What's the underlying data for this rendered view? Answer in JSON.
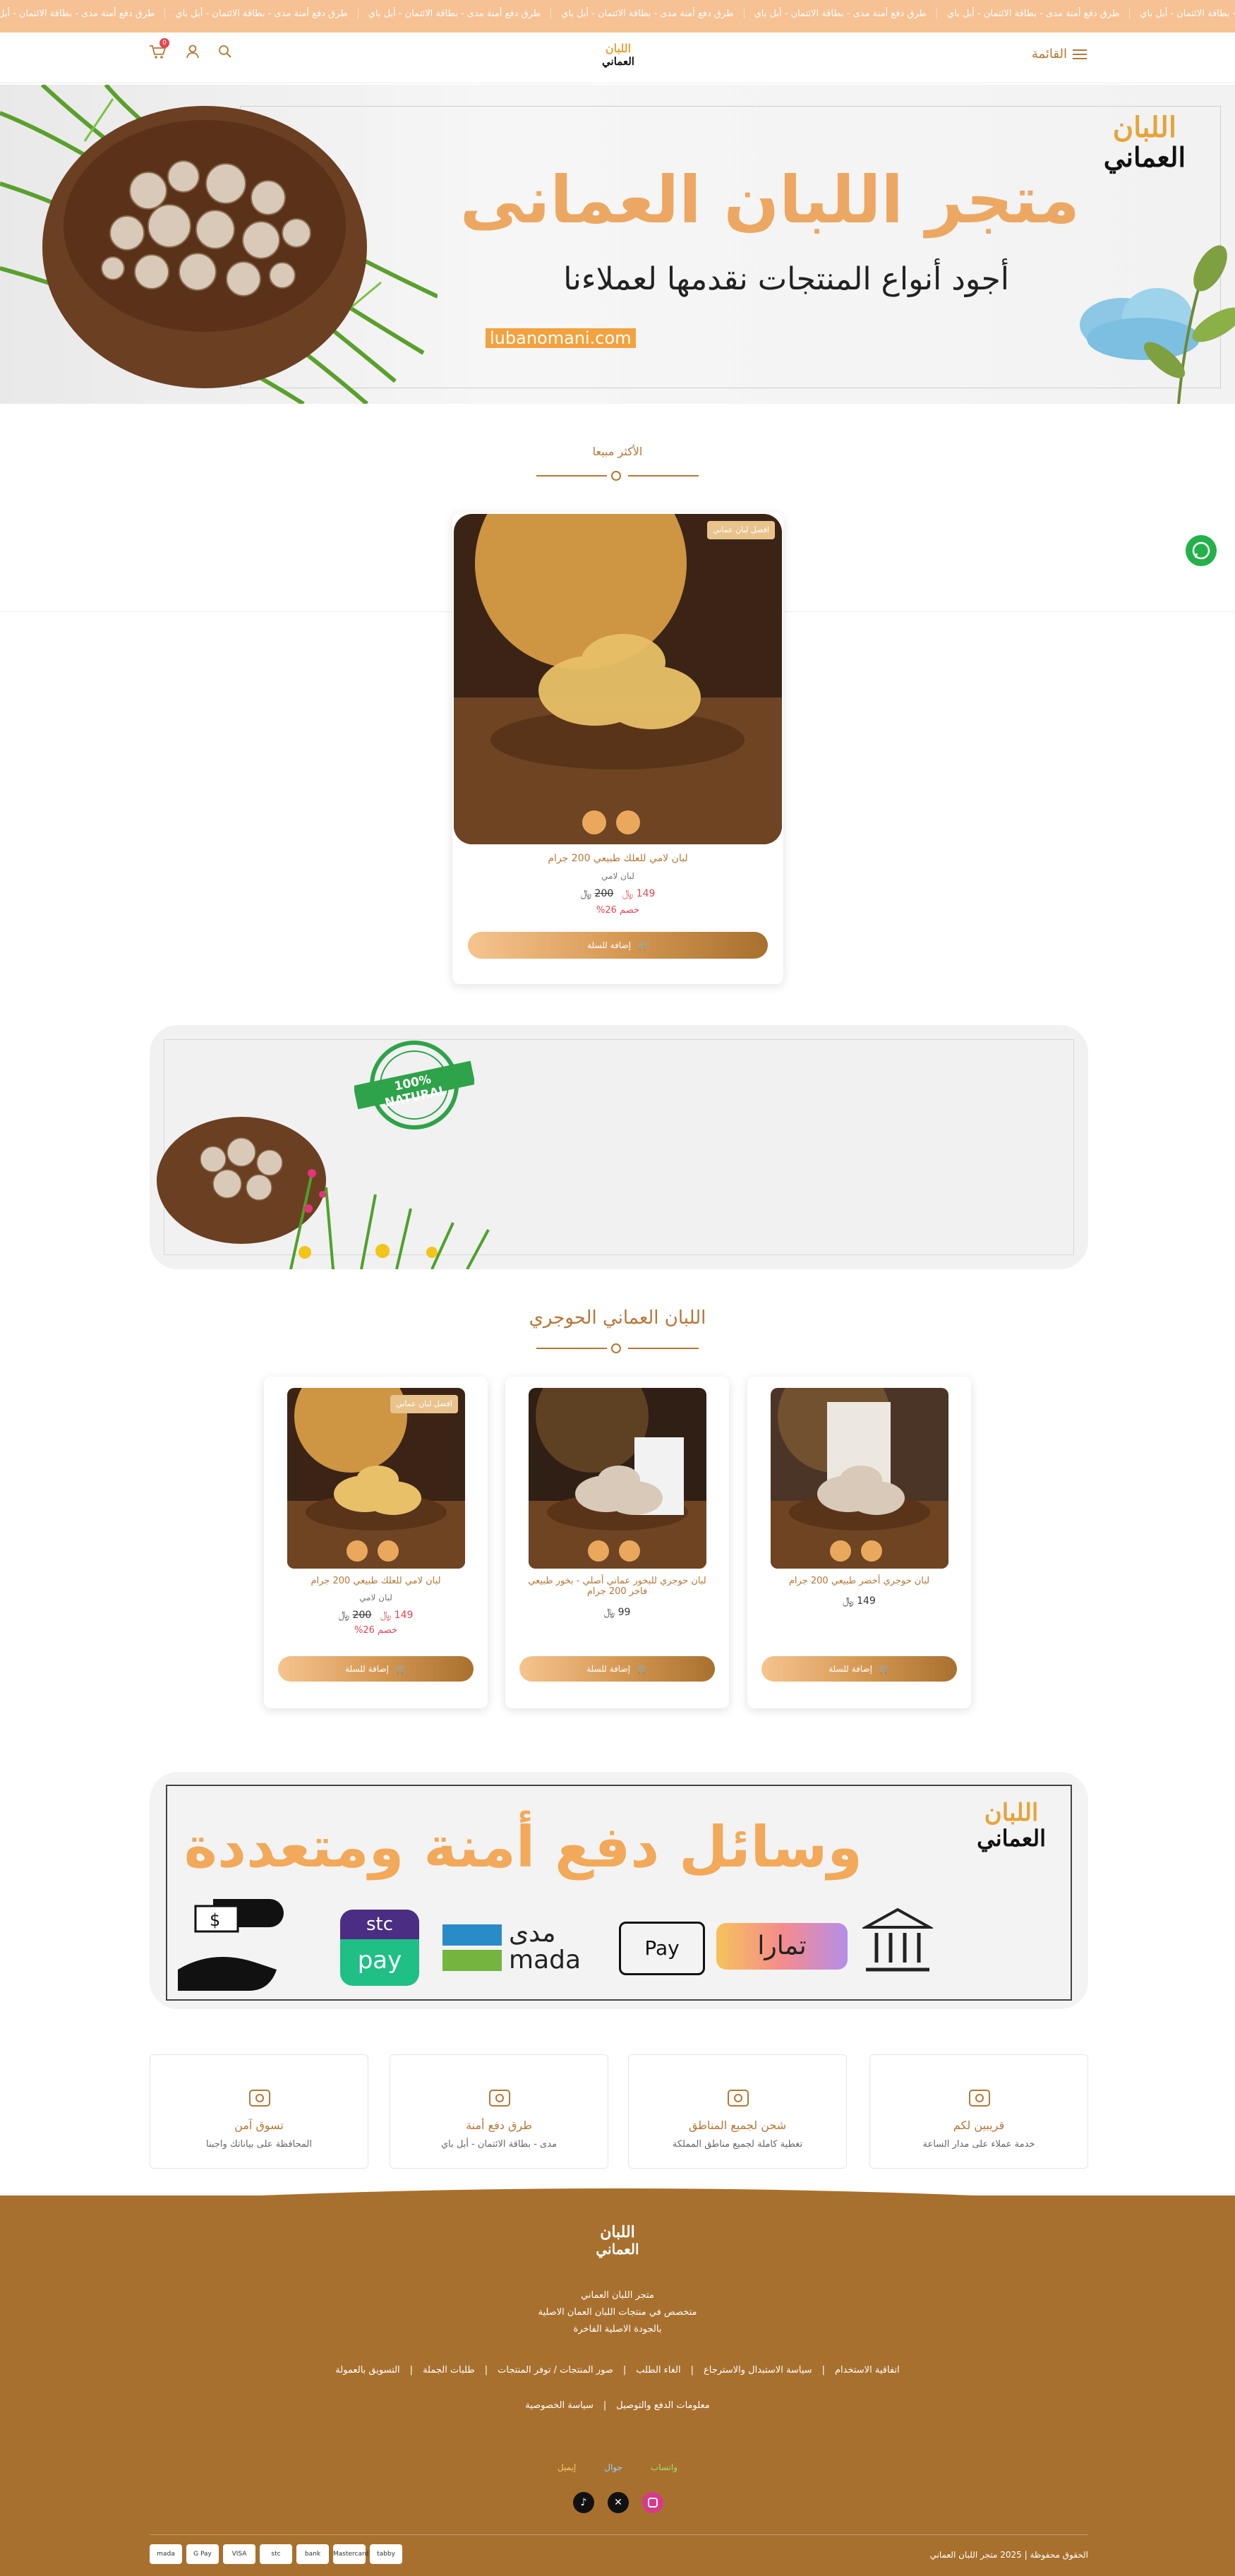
{
  "ticker": {
    "items": [
      "طرق دفع أمنة مدى - بطاقة الائتمان - أبل باي",
      "طرق دفع أمنة مدى - بطاقة الائتمان - أبل باي",
      "طرق دفع أمنة مدى - بطاقة الائتمان - أبل باي",
      "طرق دفع أمنة مدى - بطاقة الائتمان - أبل باي",
      "طرق دفع أمنة مدى - بطاقة الائتمان - أبل باي",
      "طرق دفع أمنة مدى - بطاقة الائتمان - أبل باي",
      "طرق دفع أمنة مدى - بطاقة الائتمان - أبل باي",
      "طرق دفع أمنة مدى - بطاقة الائتمان - أبل باي"
    ]
  },
  "header": {
    "menu_label": "القائمة",
    "logo_top": "اللبان",
    "logo_bottom": "العماني",
    "cart_count": "0"
  },
  "hero": {
    "title": "متجر اللبان العمانى",
    "subtitle": "أجود أنواع المنتجات نقدمها لعملاءنا",
    "url": "lubanomani.com",
    "logo_top": "اللبان",
    "logo_bottom": "العماني"
  },
  "best_seller": {
    "title": "الأكثر مبيعا",
    "product": {
      "badge": "افضل لبان عماني",
      "name": "لبان لامي للعلك طبيعي 200 جرام",
      "category": "لبان لامي",
      "price_new": "149",
      "price_old": "200",
      "discount": "خصم 26%",
      "cart_label": "إضافة للسلة"
    }
  },
  "hojari": {
    "title": "اللبان العماني الحوجري",
    "products": [
      {
        "badge": "افضل لبان عماني",
        "name": "لبان لامي للعلك طبيعي 200 جرام",
        "category": "لبان لامي",
        "price_new": "149",
        "price_old": "200",
        "discount": "خصم 26%",
        "cart_label": "إضافة للسلة"
      },
      {
        "name": "لبان حوجري للبخور عماني أصلي - بخور طبيعي فاخر 200 جرام",
        "price": "99",
        "cart_label": "إضافة للسلة"
      },
      {
        "name": "لبان حوجري أخضر طبيعي 200 جرام",
        "price": "149",
        "cart_label": "إضافة للسلة"
      }
    ]
  },
  "natural_banner": {
    "stamp": "100% NATURAL"
  },
  "payment_banner": {
    "title": "وسائل دفع أمنة ومتعددة",
    "logo_top": "اللبان",
    "logo_bottom": "العماني",
    "methods": [
      "stc pay",
      "مدى mada",
      "Apple Pay",
      "تمارا"
    ]
  },
  "features": [
    {
      "title": "قريبين لكم",
      "desc": "خدمة عملاء على مدار الساعة"
    },
    {
      "title": "شحن لجميع المناطق",
      "desc": "تغطية كاملة لجميع مناطق المملكة"
    },
    {
      "title": "طرق دفع أمنة",
      "desc": "مدى - بطاقة الائتمان - أبل باي"
    },
    {
      "title": "تسوق آمن",
      "desc": "المحافظة على بياناتك واجبنا"
    }
  ],
  "footer": {
    "logo_top": "اللبان",
    "logo_bottom": "العماني",
    "store_name": "متجر اللبان العماني",
    "desc_line1": "متخصص في منتجات اللبان العمان الاصلية",
    "desc_line2": "بالجودة الاصلية الفاخرة",
    "links_row1": [
      "اتفاقية الاستخدام",
      "سياسة الاستبدال والاسترجاع",
      "الغاء الطلب",
      "صور المنتجات / توفر المنتجات",
      "طلبات الجملة",
      "التسويق بالعمولة"
    ],
    "links_row2": [
      "معلومات الدفع والتوصيل",
      "سياسة الخصوصية"
    ],
    "contact": {
      "whatsapp": "واتساب",
      "mobile": "جوال",
      "email": "إيميل"
    },
    "copyright": "الحقوق محفوظة | 2025 متجر اللبان العماني",
    "payments": [
      "mada",
      "G Pay",
      "VISA",
      "stc",
      "bank",
      "Mastercard",
      "tabby"
    ]
  },
  "colors": {
    "brand": "#b47736",
    "accent": "#eaa85d",
    "ticker": "#f6c193",
    "sale": "#e0484e",
    "footer": "#a8702e"
  }
}
